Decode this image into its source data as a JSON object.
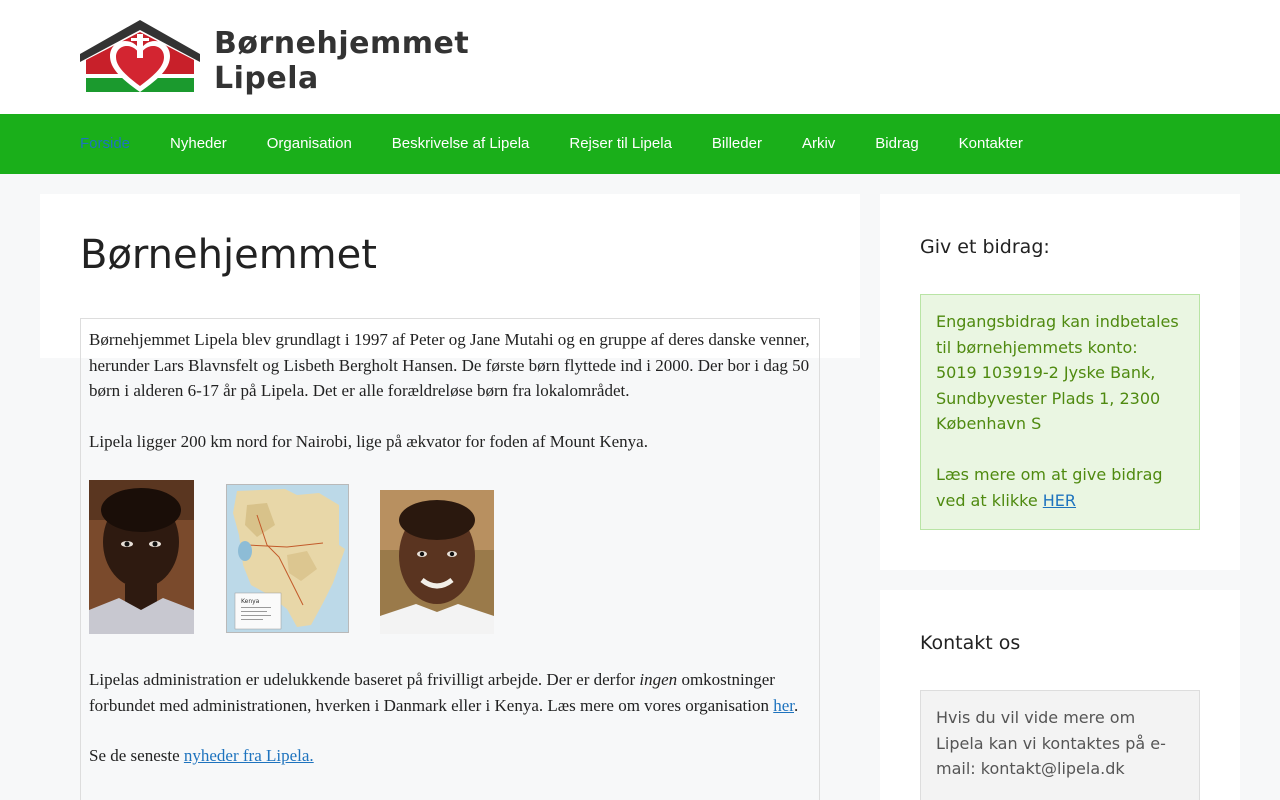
{
  "header": {
    "site_name": "Børnehjemmet Lipela"
  },
  "nav": {
    "items": [
      {
        "label": "Forside",
        "active": true
      },
      {
        "label": "Nyheder"
      },
      {
        "label": "Organisation"
      },
      {
        "label": "Beskrivelse af Lipela"
      },
      {
        "label": "Rejser til Lipela"
      },
      {
        "label": "Billeder"
      },
      {
        "label": "Arkiv"
      },
      {
        "label": "Bidrag"
      },
      {
        "label": "Kontakter"
      }
    ]
  },
  "main": {
    "title": "Børnehjemmet",
    "para1": "Børnehjemmet Lipela blev grundlagt i 1997 af Peter og Jane Mutahi og en gruppe af deres danske venner, herunder Lars Blavnsfelt og Lisbeth Bergholt Hansen. De første børn flyttede ind i 2000. Der bor i dag 50 børn i alderen 6-17 år på Lipela. Det er alle forældreløse børn fra lokalområdet.",
    "para2": "Lipela ligger 200 km nord for Nairobi, lige på ækvator for foden af Mount Kenya.",
    "para3_before": "Lipelas administration er udelukkende baseret på frivilligt arbejde. Der er derfor ",
    "para3_em": "ingen",
    "para3_after": " omkostninger forbundet med administrationen, hverken i Danmark eller i Kenya. Læs mere om vores organisation ",
    "para3_link": "her",
    "para3_end": ".",
    "para4_before": "Se de seneste ",
    "para4_link": "nyheder fra Lipela.",
    "map_label": "Kenya"
  },
  "sidebar": {
    "donate": {
      "title": "Giv et bidrag:",
      "line1": "Engangsbidrag kan indbetales til børnehjemmets konto:",
      "line2": "5019 103919-2 Jyske Bank, Sundbyvester Plads 1, 2300 København S",
      "line3": "Læs mere om at give bidrag ved at klikke ",
      "link": "HER"
    },
    "contact": {
      "title": "Kontakt os",
      "text": "Hvis du vil vide mere om Lipela kan vi kontaktes på e-mail: kontakt@lipela.dk"
    }
  },
  "colors": {
    "nav_bg": "#1aaf1a",
    "active_nav": "#1e73be",
    "link": "#1e73be",
    "donate_bg": "#eaf6e2",
    "donate_text": "#4f8a10"
  }
}
